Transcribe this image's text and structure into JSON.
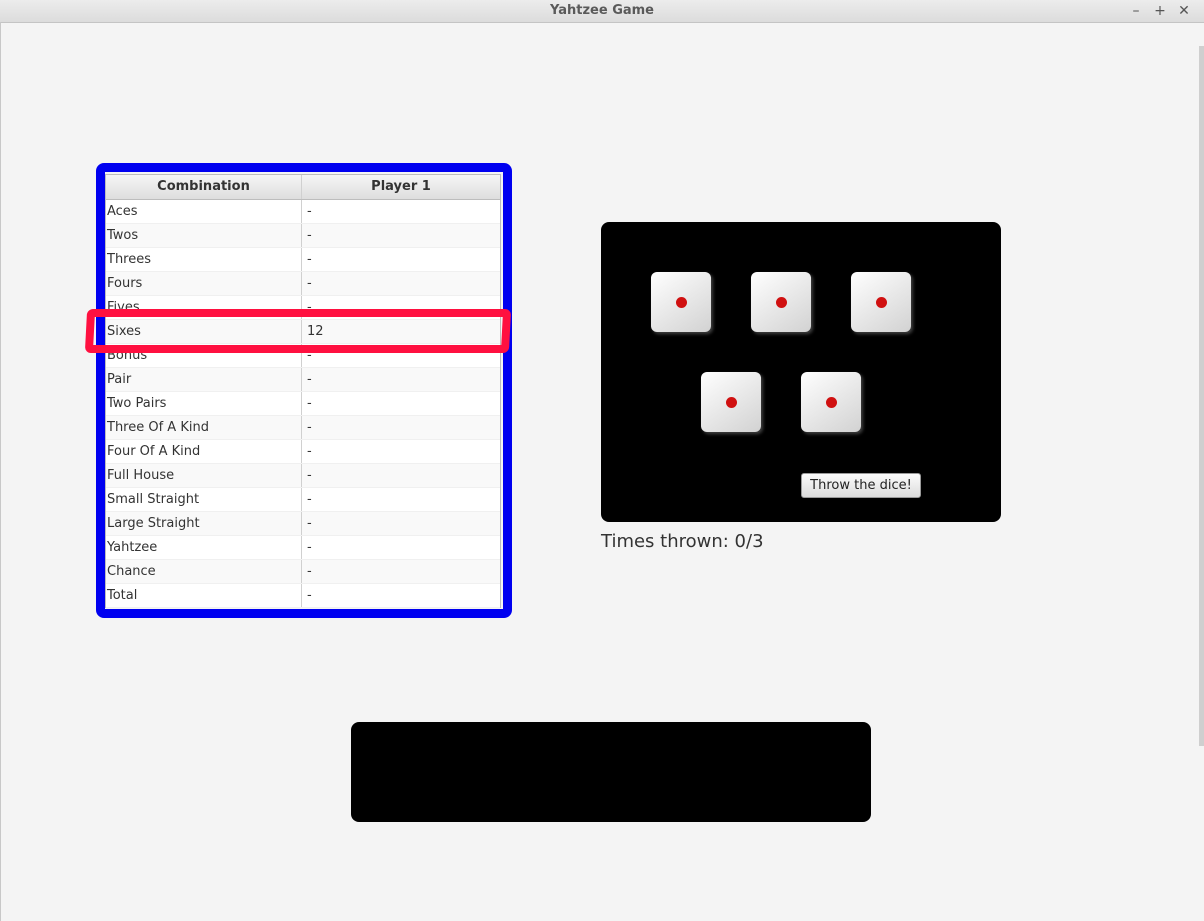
{
  "window": {
    "title": "Yahtzee Game",
    "controls": {
      "minimize": "–",
      "maximize": "+",
      "close": "✕"
    }
  },
  "score_table": {
    "headers": [
      "Combination",
      "Player 1"
    ],
    "rows": [
      [
        "Aces",
        "-"
      ],
      [
        "Twos",
        "-"
      ],
      [
        "Threes",
        "-"
      ],
      [
        "Fours",
        "-"
      ],
      [
        "Fives",
        "-"
      ],
      [
        "Sixes",
        "12"
      ],
      [
        "Bonus",
        "-"
      ],
      [
        "Pair",
        "-"
      ],
      [
        "Two Pairs",
        "-"
      ],
      [
        "Three Of A Kind",
        "-"
      ],
      [
        "Four Of A Kind",
        "-"
      ],
      [
        "Full House",
        "-"
      ],
      [
        "Small Straight",
        "-"
      ],
      [
        "Large Straight",
        "-"
      ],
      [
        "Yahtzee",
        "-"
      ],
      [
        "Chance",
        "-"
      ],
      [
        "Total",
        "-"
      ]
    ]
  },
  "highlights": {
    "table_outline_color": "#0000f0",
    "row_outline_color": "#ff1040",
    "highlighted_row": "Sixes"
  },
  "dice": {
    "values": [
      1,
      1,
      1,
      1,
      1
    ],
    "pip_color": "#d01010",
    "throw_button_label": "Throw the dice!"
  },
  "status": {
    "times_thrown": "Times thrown: 0/3"
  }
}
